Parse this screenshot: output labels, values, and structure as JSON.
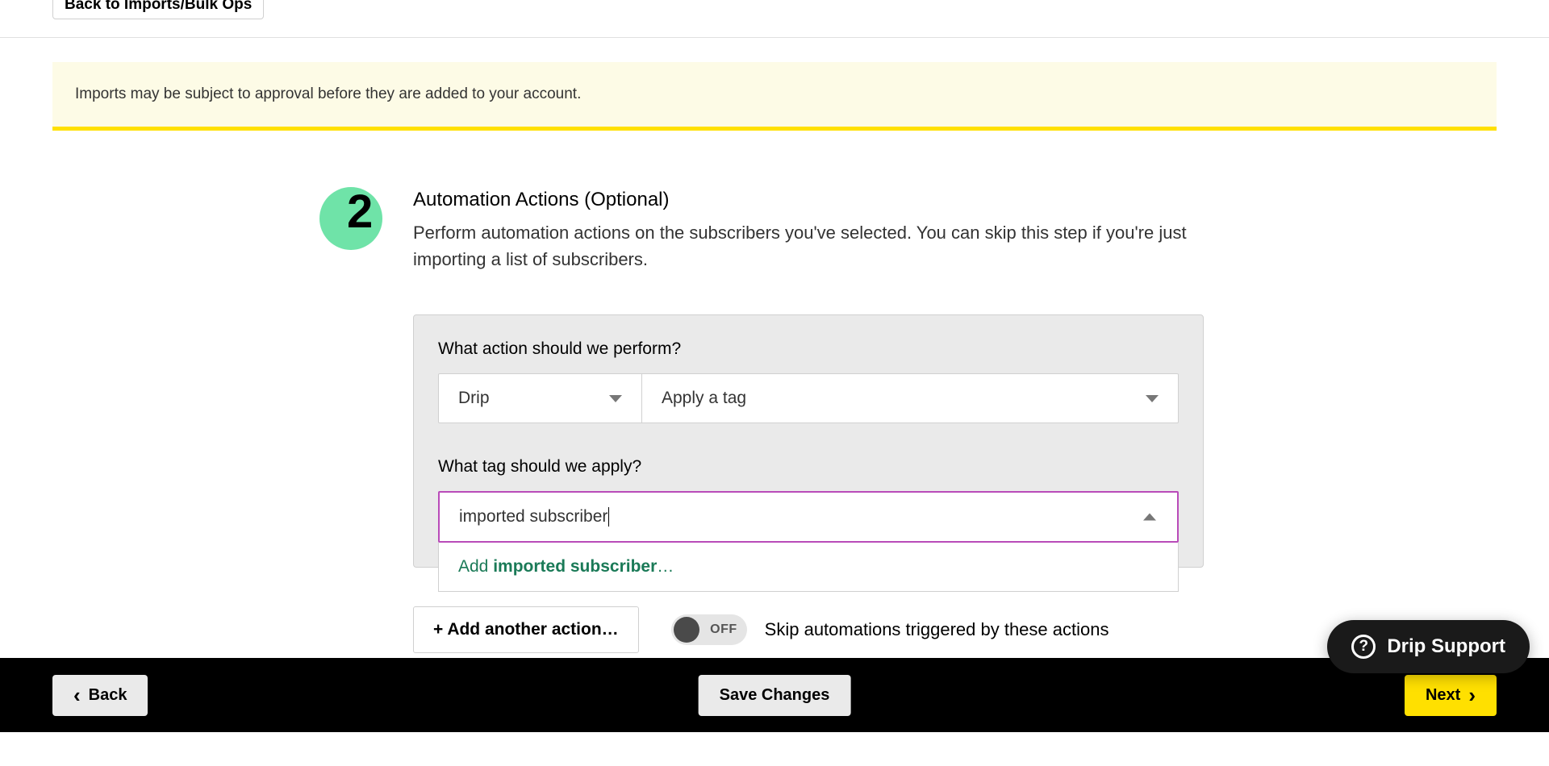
{
  "topbar": {
    "back_link": "Back to Imports/Bulk Ops"
  },
  "notice": {
    "text": "Imports may be subject to approval before they are added to your account."
  },
  "step": {
    "number": "2",
    "title": "Automation Actions (Optional)",
    "description": "Perform automation actions on the subscribers you've selected. You can skip this step if you're just importing a list of subscribers."
  },
  "action": {
    "label_action": "What action should we perform?",
    "source_value": "Drip",
    "action_value": "Apply a tag",
    "label_tag": "What tag should we apply?",
    "tag_input_value": "imported subscriber",
    "dropdown_prefix": "Add ",
    "dropdown_term": "imported subscriber",
    "dropdown_suffix": "…"
  },
  "below": {
    "add_another": "+ Add another action…",
    "toggle_state": "OFF",
    "skip_text": "Skip automations triggered by these actions"
  },
  "footer": {
    "back": "Back",
    "save": "Save Changes",
    "next": "Next"
  },
  "support": {
    "label": "Drip Support",
    "icon_char": "?"
  }
}
